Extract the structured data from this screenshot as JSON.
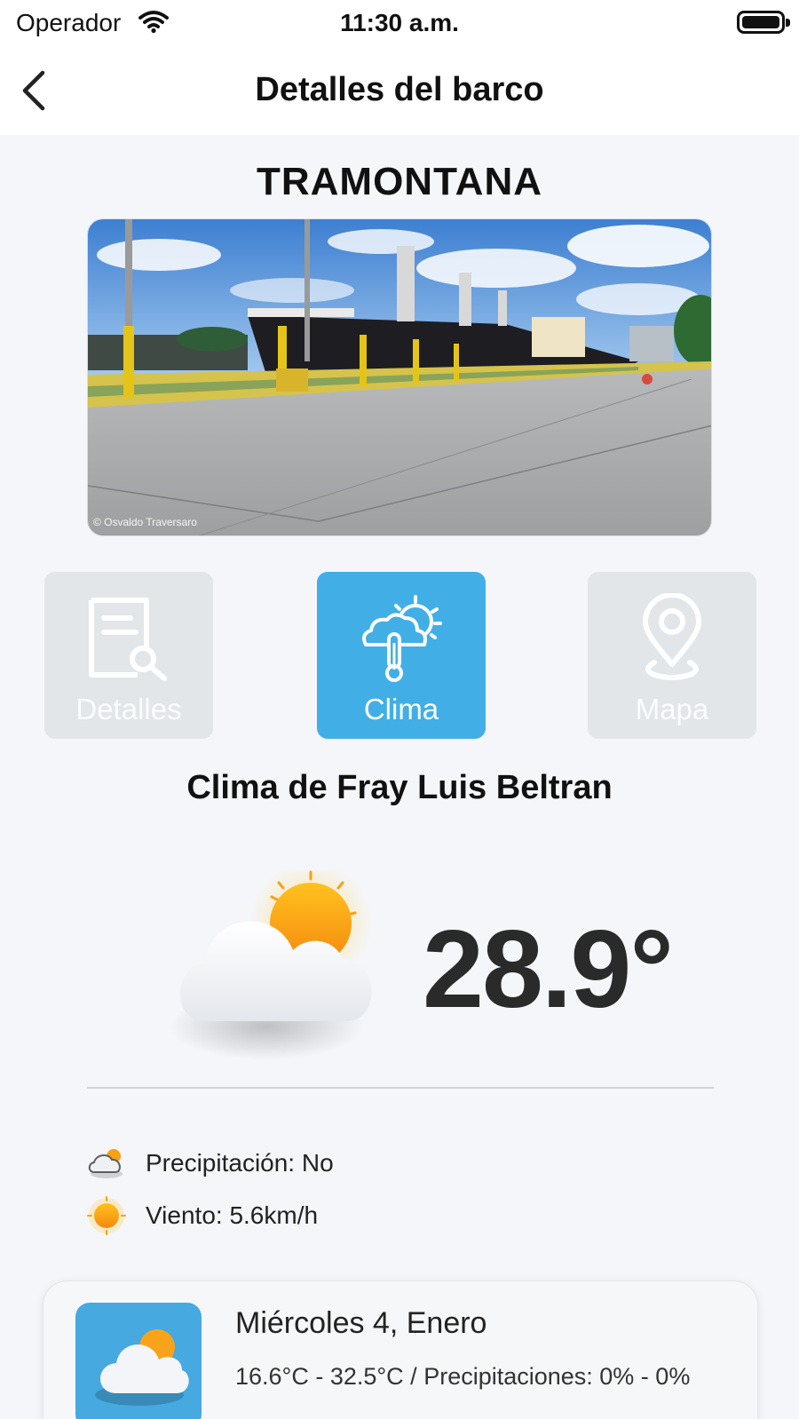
{
  "status_bar": {
    "carrier": "Operador",
    "time": "11:30 a.m.",
    "wifi_icon": "wifi-icon",
    "battery_icon": "battery-icon"
  },
  "nav": {
    "title": "Detalles del barco",
    "back_icon": "chevron-left-icon"
  },
  "ship": {
    "name": "TRAMONTANA",
    "photo_credit": "© Osvaldo Traversaro"
  },
  "tabs": [
    {
      "label": "Detalles",
      "icon": "document-search-icon",
      "active": false
    },
    {
      "label": "Clima",
      "icon": "weather-thermometer-icon",
      "active": true
    },
    {
      "label": "Mapa",
      "icon": "map-pin-icon",
      "active": false
    }
  ],
  "weather": {
    "title": "Clima de Fray Luis Beltran",
    "temperature": "28.9°",
    "condition_icon": "partly-cloudy-icon",
    "precipitation": "Precipitación: No",
    "wind": "Viento: 5.6km/h"
  },
  "forecast": [
    {
      "day": "Miércoles 4, Enero",
      "detail": "16.6°C - 32.5°C  / Precipitaciones: 0% - 0%",
      "icon": "partly-cloudy-icon"
    }
  ],
  "colors": {
    "accent": "#41afe6",
    "tab_inactive": "#e2e6e9",
    "background": "#f4f6f9",
    "sun": "#f9a31a"
  }
}
